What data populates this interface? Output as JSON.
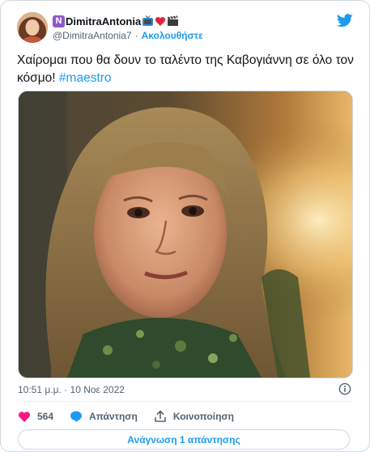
{
  "tweet": {
    "author": {
      "badge": "Ν",
      "display_name": "DimitraAntonia",
      "name_emojis": [
        "tv-icon",
        "heart-icon",
        "clapperboard-icon"
      ],
      "handle": "@DimitraAntonia7",
      "separator": "·",
      "follow_label": "Ακολουθήστε"
    },
    "text": "Χαίρομαι που θα δουν το ταλέντο της Καβογιάννη σε όλο τον κόσμο! ",
    "hashtag": "#maestro",
    "media": {
      "type": "photo",
      "subject": "woman-portrait"
    },
    "timestamp": "10:51 μ.μ. · 10 Νοε 2022",
    "actions": {
      "likes_count": "564",
      "reply_label": "Απάντηση",
      "share_label": "Κοινοποίηση"
    },
    "read_replies_label": "Ανάγνωση 1 απάντησης"
  },
  "colors": {
    "accent": "#1d9bf0",
    "like": "#f91880",
    "secondary_text": "#536471",
    "border": "#cfd9de"
  }
}
